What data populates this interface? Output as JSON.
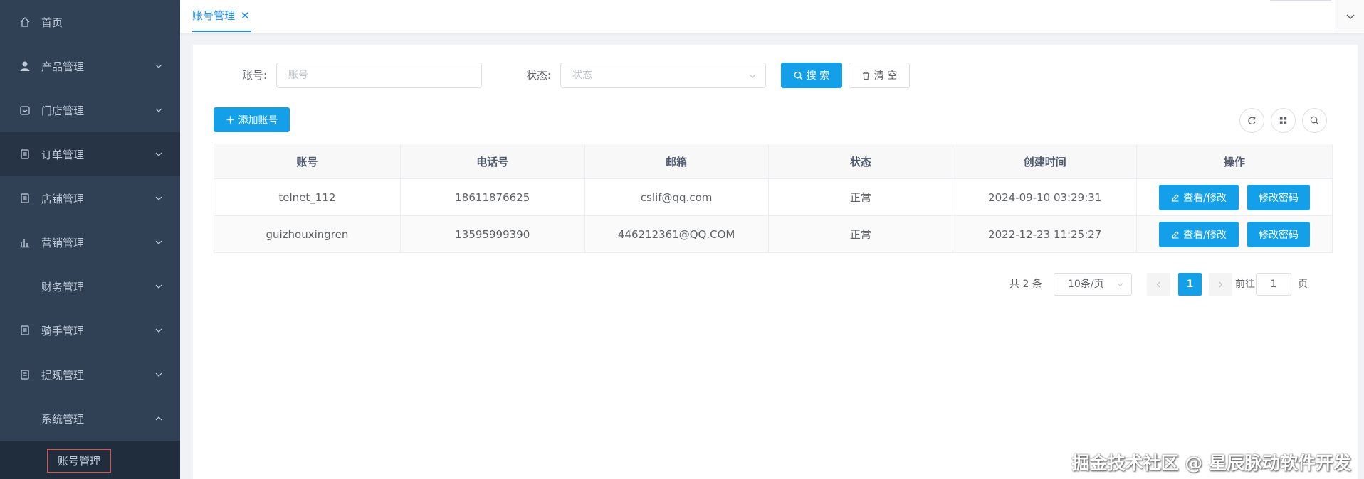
{
  "sidebar": {
    "items": [
      {
        "label": "首页",
        "icon": "home-icon"
      },
      {
        "label": "产品管理",
        "icon": "user-icon"
      },
      {
        "label": "门店管理",
        "icon": "store-icon"
      },
      {
        "label": "订单管理",
        "icon": "document-icon"
      },
      {
        "label": "店铺管理",
        "icon": "document-icon"
      },
      {
        "label": "营销管理",
        "icon": "bar-chart-icon"
      },
      {
        "label": "财务管理",
        "icon": ""
      },
      {
        "label": "骑手管理",
        "icon": "document-icon"
      },
      {
        "label": "提现管理",
        "icon": "document-icon"
      },
      {
        "label": "系统管理",
        "icon": ""
      }
    ],
    "sub_item": "账号管理"
  },
  "tabs": {
    "active": "账号管理",
    "close": "✕"
  },
  "filters": {
    "account_label": "账号:",
    "account_placeholder": "账号",
    "status_label": "状态:",
    "status_placeholder": "状态",
    "search_button": "搜 索",
    "clear_button": "清 空"
  },
  "toolbar": {
    "add_button": "添加账号"
  },
  "table": {
    "headers": [
      "账号",
      "电话号",
      "邮箱",
      "状态",
      "创建时间",
      "操作"
    ],
    "rows": [
      {
        "account": "telnet_112",
        "phone": "18611876625",
        "email": "cslif@qq.com",
        "status": "正常",
        "created": "2024-09-10 03:29:31"
      },
      {
        "account": "guizhouxingren",
        "phone": "13595999390",
        "email": "446212361@QQ.COM",
        "status": "正常",
        "created": "2022-12-23 11:25:27"
      }
    ],
    "view_edit_label": "查看/修改",
    "change_password_label": "修改密码"
  },
  "pagination": {
    "total": "共 2 条",
    "page_size": "10条/页",
    "current_page": "1",
    "goto_label": "前往",
    "goto_value": "1",
    "page_suffix": "页"
  },
  "watermark": "掘金技术社区 @ 星辰脉动软件开发",
  "colors": {
    "sidebar_bg": "#304156",
    "primary": "#13a0e8",
    "tab_active": "#1890ff"
  }
}
